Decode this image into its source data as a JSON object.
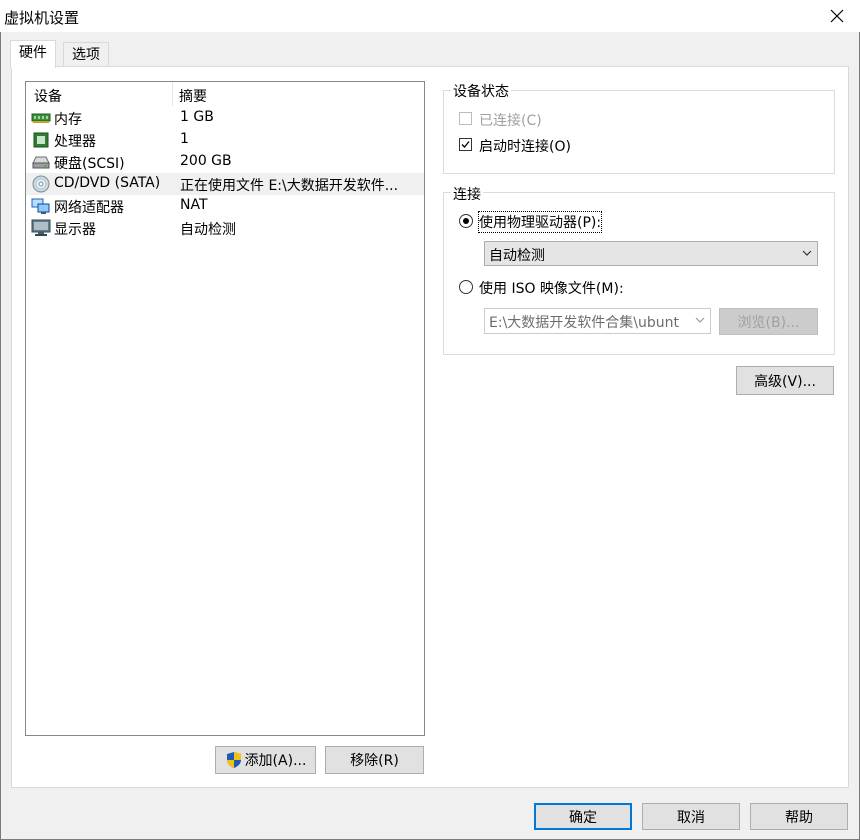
{
  "window": {
    "title": "虚拟机设置"
  },
  "tabs": [
    {
      "label": "硬件",
      "active": true
    },
    {
      "label": "选项",
      "active": false
    }
  ],
  "device_list": {
    "columns": [
      "设备",
      "摘要"
    ],
    "rows": [
      {
        "name": "内存",
        "summary": "1 GB",
        "icon": "memory-icon"
      },
      {
        "name": "处理器",
        "summary": "1",
        "icon": "processor-icon"
      },
      {
        "name": "硬盘(SCSI)",
        "summary": "200 GB",
        "icon": "hard-disk-icon"
      },
      {
        "name": "CD/DVD (SATA)",
        "summary": "正在使用文件 E:\\大数据开发软件...",
        "icon": "cd-dvd-icon",
        "selected": true
      },
      {
        "name": "网络适配器",
        "summary": "NAT",
        "icon": "network-adapter-icon"
      },
      {
        "name": "显示器",
        "summary": "自动检测",
        "icon": "display-icon"
      }
    ]
  },
  "list_buttons": {
    "add_label": "添加(A)...",
    "remove_label": "移除(R)"
  },
  "device_status": {
    "title": "设备状态",
    "connected_label": "已连接(C)",
    "connected_checked": false,
    "connected_enabled": false,
    "connect_on_power_on_label": "启动时连接(O)",
    "connect_on_power_on_checked": true
  },
  "connection": {
    "title": "连接",
    "physical_drive_label": "使用物理驱动器(P):",
    "physical_drive_selected": true,
    "physical_drive_value": "自动检测",
    "iso_label": "使用 ISO 映像文件(M):",
    "iso_selected": false,
    "iso_path": "E:\\大数据开发软件合集\\ubunt",
    "browse_label": "浏览(B)..."
  },
  "advanced_label": "高级(V)...",
  "dialog_buttons": {
    "ok": "确定",
    "cancel": "取消",
    "help": "帮助"
  },
  "colors": {
    "accent": "#0078d7",
    "window_bg": "#f0f0f0",
    "panel_bg": "#ffffff"
  }
}
